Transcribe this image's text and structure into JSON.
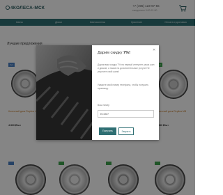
{
  "header": {
    "logo": "4КОЛЕСА-МСК",
    "phone": "+7 (495) 123-97-56",
    "phone_sub": "ежедневно 9:00-21:00"
  },
  "nav": {
    "items": [
      "Шины",
      "Диски",
      "Шиномонтаж",
      "Хранение",
      "Оплата и доставка"
    ]
  },
  "section": {
    "title": "Лучшие предложения"
  },
  "products": [
    {
      "badge": "Хит",
      "title": "Колесный диск Replica LX 11",
      "price": "4 800 ₽/шт"
    },
    {
      "badge": "Хит",
      "title": "Колесный диск Replica MB 12",
      "price": "3 980 ₽/шт"
    }
  ],
  "modal": {
    "title_prefix": "Дарим скидку ",
    "title_value": "7%",
    "title_suffix": "!",
    "text1": "Дарим вам скидку 7% на первый интернет-заказ шин и дисков, а также на дополнительные услуги! Не упустите свой шанс!",
    "text2": "Укажите свой номер телефона, чтобы получить промокод.",
    "field_label": "Ваш номер",
    "field_value": "ECOM7",
    "primary_button": "Получить",
    "secondary_button": "Закрыть"
  },
  "colors": {
    "brand": "#2f6f73",
    "accent": "#c47b2a",
    "badge_blue": "#4a7fc1",
    "badge_green": "#3fa34d"
  }
}
